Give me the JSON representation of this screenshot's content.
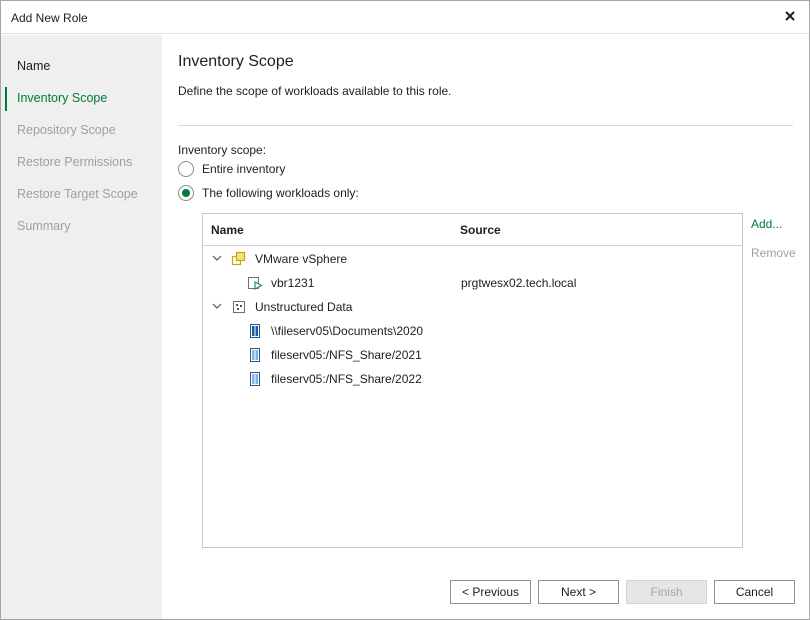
{
  "window": {
    "title": "Add New Role"
  },
  "steps": [
    {
      "label": "Name",
      "state": "done"
    },
    {
      "label": "Inventory Scope",
      "state": "active"
    },
    {
      "label": "Repository Scope",
      "state": "pending"
    },
    {
      "label": "Restore Permissions",
      "state": "pending"
    },
    {
      "label": "Restore Target Scope",
      "state": "pending"
    },
    {
      "label": "Summary",
      "state": "pending"
    }
  ],
  "page": {
    "heading": "Inventory Scope",
    "description": "Define the scope of workloads available to this role.",
    "scope_label": "Inventory scope:",
    "options": [
      {
        "label": "Entire inventory",
        "selected": false
      },
      {
        "label": "The following workloads only:",
        "selected": true
      }
    ]
  },
  "grid": {
    "columns": {
      "name": "Name",
      "source": "Source"
    },
    "rows": [
      {
        "name": "VMware vSphere",
        "source": "",
        "icon": "vmware-icon",
        "expanded": true
      },
      {
        "name": "vbr1231",
        "source": "prgtwesx02.tech.local",
        "icon": "vm-icon"
      },
      {
        "name": "Unstructured Data",
        "source": "",
        "icon": "unstructured-data-icon",
        "expanded": true
      },
      {
        "name": "\\\\fileserv05\\Documents\\2020",
        "source": "",
        "icon": "file-share-icon"
      },
      {
        "name": "fileserv05:/NFS_Share/2021",
        "source": "",
        "icon": "nfs-share-icon"
      },
      {
        "name": "fileserv05:/NFS_Share/2022",
        "source": "",
        "icon": "nfs-share-icon"
      }
    ]
  },
  "actions": {
    "add": "Add...",
    "remove": "Remove"
  },
  "buttons": {
    "previous": "< Previous",
    "next": "Next >",
    "finish": "Finish",
    "cancel": "Cancel"
  },
  "colors": {
    "accent": "#007b3a",
    "sidebar_bg": "#efefef",
    "disabled_text": "#a0a0a0"
  }
}
